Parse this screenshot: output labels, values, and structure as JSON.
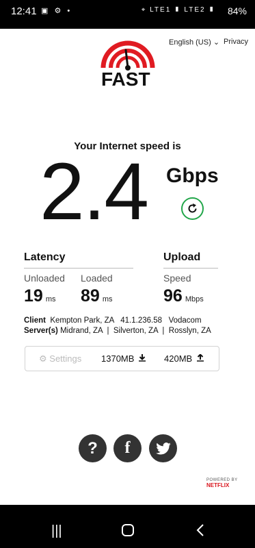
{
  "status_bar": {
    "time": "12:41",
    "left_icons": "▣ ⚙ •",
    "right_icons": "⌖ LTE1 ▮ LTE2 ▮",
    "battery": "84%"
  },
  "header": {
    "language": "English (US)",
    "language_caret": "⌄",
    "privacy": "Privacy",
    "logo_text": "FAST"
  },
  "speed": {
    "title": "Your Internet speed is",
    "value": "2.4",
    "units": "Gbps"
  },
  "latency": {
    "title": "Latency",
    "unloaded_label": "Unloaded",
    "unloaded_value": "19",
    "unloaded_unit": "ms",
    "loaded_label": "Loaded",
    "loaded_value": "89",
    "loaded_unit": "ms"
  },
  "upload": {
    "title": "Upload",
    "speed_label": "Speed",
    "speed_value": "96",
    "speed_unit": "Mbps"
  },
  "client": {
    "label": "Client",
    "value": "Kempton Park, ZA   41.1.236.58   Vodacom"
  },
  "servers": {
    "label": "Server(s)",
    "value": "Midrand, ZA  |  Silverton, ZA  |  Rosslyn, ZA"
  },
  "data_usage": {
    "settings_label": "Settings",
    "download": "1370MB",
    "upload": "420MB"
  },
  "footer": {
    "powered_by": "POWERED BY",
    "brand": "NETFLIX"
  },
  "colors": {
    "logo_red": "#e01b22",
    "refresh_green": "#22a64a",
    "netflix_red": "#d9151d"
  }
}
